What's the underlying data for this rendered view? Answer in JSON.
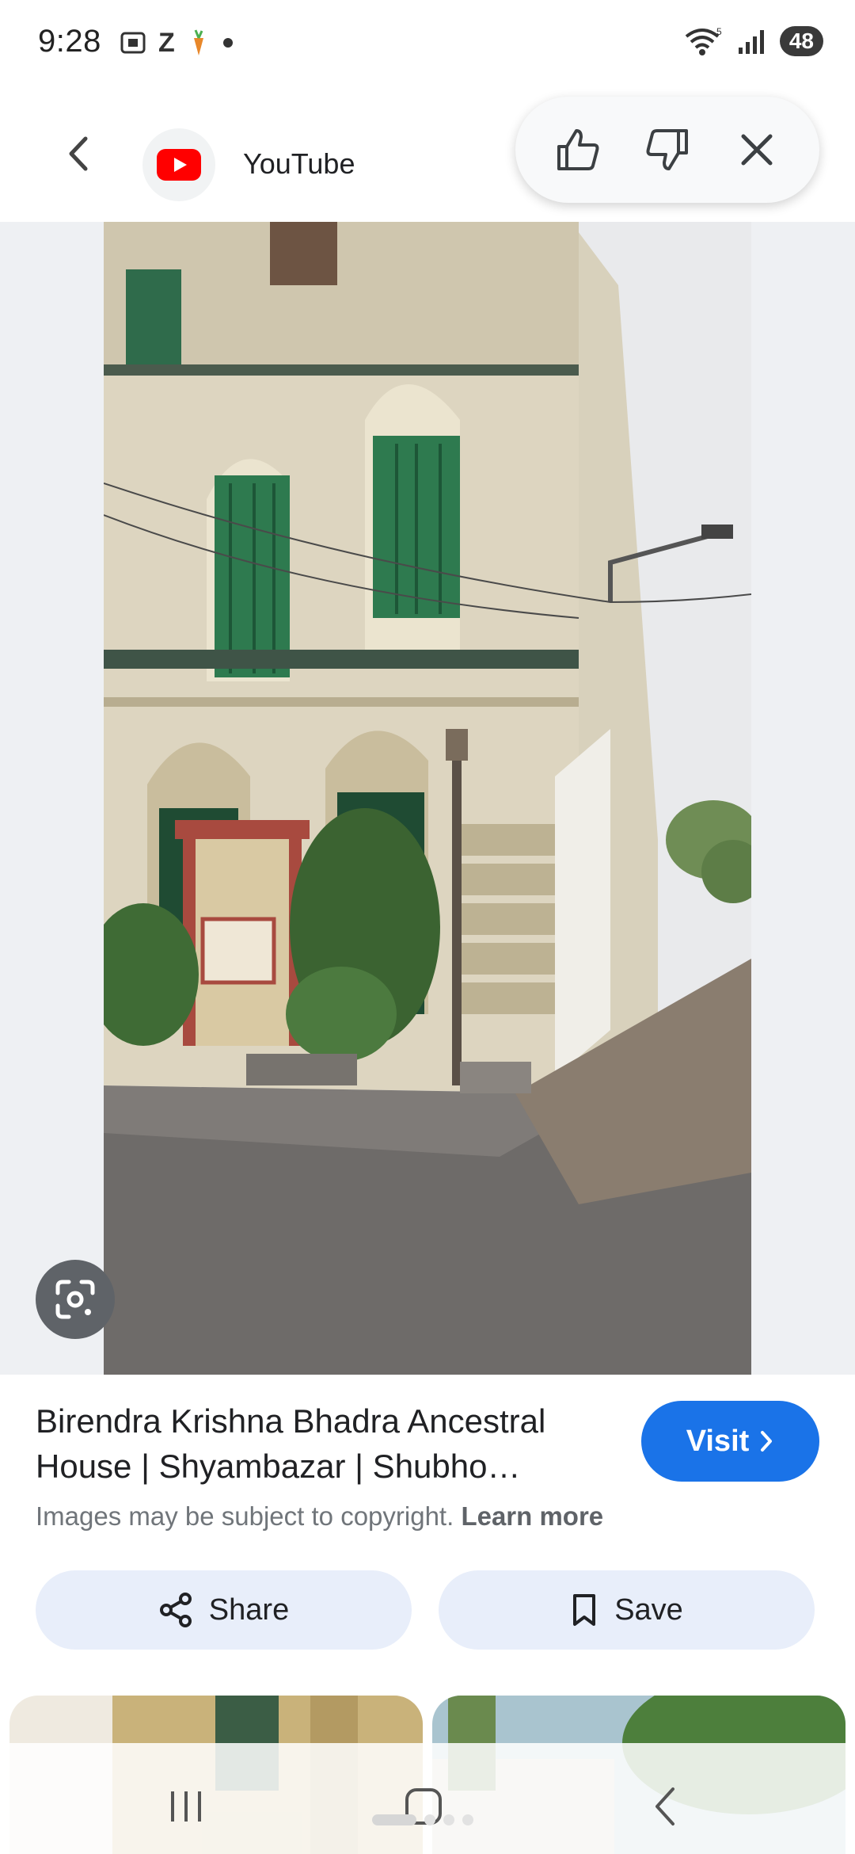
{
  "status_bar": {
    "time": "9:28",
    "left_icons": [
      "screenshot-icon",
      "z-icon",
      "carrot-icon",
      "dot-icon"
    ],
    "right_icons": [
      "wifi-icon",
      "signal-icon"
    ],
    "wifi_label": "5",
    "battery": "48"
  },
  "header": {
    "source_name": "YouTube",
    "source_icon": "youtube-logo",
    "brand_color": "#FF0000"
  },
  "feedback": {
    "icons": [
      "thumbs-up-icon",
      "thumbs-down-icon",
      "close-icon"
    ]
  },
  "result": {
    "title_line1": "Birendra Krishna Bhadra Ancestral",
    "title_line2": "House | Shyambazar | Shubho…",
    "visit_label": "Visit",
    "copyright_text": "Images may be subject to copyright.",
    "learn_more": "Learn more",
    "accent_color": "#1a73e8"
  },
  "actions": {
    "share_label": "Share",
    "save_label": "Save"
  },
  "nav": {
    "icons": [
      "recent-apps-icon",
      "home-icon",
      "back-icon"
    ]
  }
}
